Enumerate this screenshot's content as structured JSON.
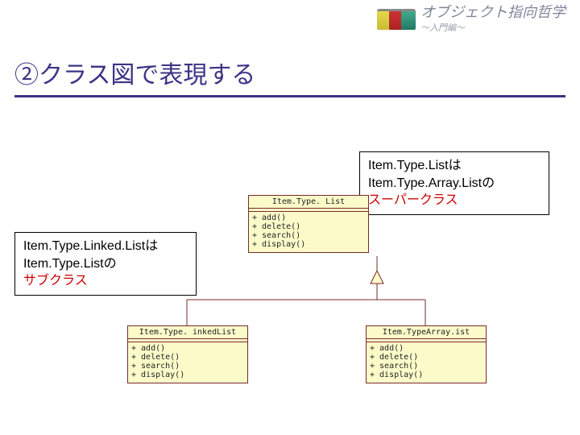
{
  "header": {
    "title": "オブジェクト指向哲学",
    "subtitle": "～入門編～"
  },
  "slide": {
    "title": "②クラス図で表現する"
  },
  "notes": {
    "right": {
      "line1": "Item.Type.Listは",
      "line2": "Item.Type.Array.Listの",
      "line3_red": "スーパークラス"
    },
    "left": {
      "line1": "Item.Type.Linked.Listは",
      "line2": "Item.Type.Listの",
      "line3_red": "サブクラス"
    }
  },
  "uml": {
    "parent": {
      "name": "Item.Type. List",
      "ops": "+ add()\n+ delete()\n+ search()\n+ display()"
    },
    "left": {
      "name": "Item.Type. inkedList",
      "ops": "+ add()\n+ delete()\n+ search()\n+ display()"
    },
    "right": {
      "name": "Item.TypeArray.ist",
      "ops": "+ add()\n+ delete()\n+ search()\n+ display()"
    }
  },
  "chart_data": {
    "type": "uml_class_diagram",
    "classes": [
      {
        "name": "ItemTypeList",
        "operations": [
          "+ add()",
          "+ delete()",
          "+ search()",
          "+ display()"
        ]
      },
      {
        "name": "ItemTypeLinkedList",
        "operations": [
          "+ add()",
          "+ delete()",
          "+ search()",
          "+ display()"
        ]
      },
      {
        "name": "ItemTypeArrayList",
        "operations": [
          "+ add()",
          "+ delete()",
          "+ search()",
          "+ display()"
        ]
      }
    ],
    "generalizations": [
      {
        "child": "ItemTypeLinkedList",
        "parent": "ItemTypeList"
      },
      {
        "child": "ItemTypeArrayList",
        "parent": "ItemTypeList"
      }
    ],
    "annotations": [
      {
        "text": "Item.Type.Linked.Listは Item.Type.Listの サブクラス",
        "refers_to": "ItemTypeLinkedList"
      },
      {
        "text": "Item.Type.Listは Item.Type.Array.Listの スーパークラス",
        "refers_to": "ItemTypeList"
      }
    ]
  }
}
